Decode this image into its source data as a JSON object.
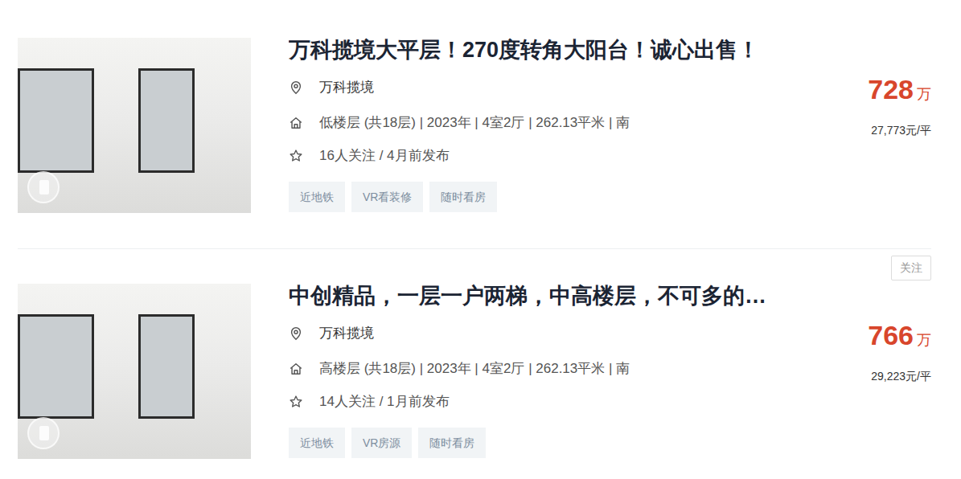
{
  "listings": [
    {
      "title": "万科揽境大平层！270度转角大阳台！诚心出售！",
      "location": "万科揽境",
      "info": "低楼层 (共18层) | 2023年 | 4室2厅 | 262.13平米 | 南",
      "follow": "16人关注 / 4月前发布",
      "tags": [
        "近地铁",
        "VR看装修",
        "随时看房"
      ],
      "price": "728",
      "price_unit": "万",
      "unit_price": "27,773元/平"
    },
    {
      "follow_button": "关注",
      "title": "中创精品，一层一户两梯，中高楼层，不可多的…",
      "location": "万科揽境",
      "info": "高楼层 (共18层) | 2023年 | 4室2厅 | 262.13平米 | 南",
      "follow": "14人关注 / 1月前发布",
      "tags": [
        "近地铁",
        "VR房源",
        "随时看房"
      ],
      "price": "766",
      "price_unit": "万",
      "unit_price": "29,223元/平"
    }
  ]
}
